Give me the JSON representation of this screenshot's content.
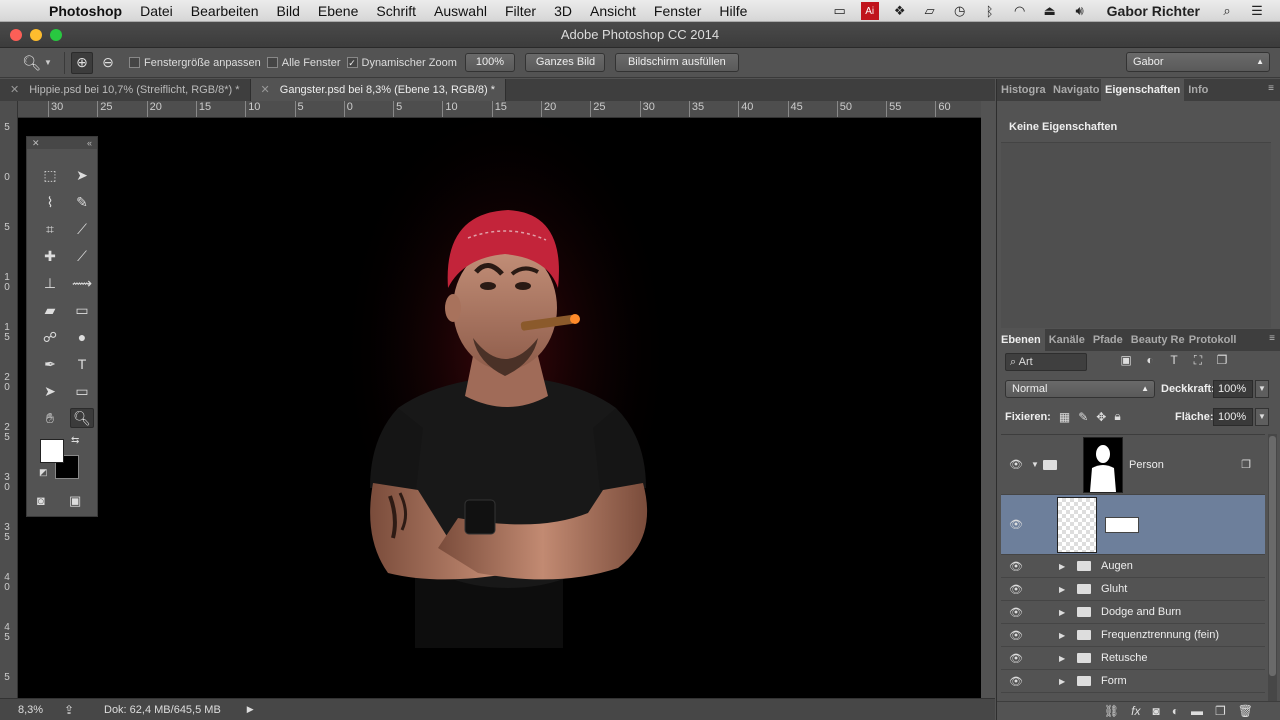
{
  "menubar": {
    "app": "Photoshop",
    "items": [
      "Datei",
      "Bearbeiten",
      "Bild",
      "Ebene",
      "Schrift",
      "Auswahl",
      "Filter",
      "3D",
      "Ansicht",
      "Fenster",
      "Hilfe"
    ],
    "user": "Gabor Richter",
    "status_icons": [
      "display-icon",
      "adobe-icon",
      "dropbox-icon",
      "airplay-icon",
      "timemachine-icon",
      "bluetooth-icon",
      "wifi-icon",
      "eject-icon",
      "volume-icon"
    ]
  },
  "window": {
    "title": "Adobe Photoshop CC 2014"
  },
  "options": {
    "fit_window": "Fenstergröße anpassen",
    "all_windows": "Alle Fenster",
    "dynamic_zoom": "Dynamischer Zoom",
    "zoom_value": "100%",
    "whole_image": "Ganzes Bild",
    "fill_screen": "Bildschirm ausfüllen",
    "workspace": "Gabor"
  },
  "doc_tabs": [
    {
      "label": "Hippie.psd bei 10,7% (Streiflicht, RGB/8*) *",
      "active": false
    },
    {
      "label": "Gangster.psd bei 8,3% (Ebene 13, RGB/8) *",
      "active": true
    }
  ],
  "ruler": {
    "h_ticks": [
      "30",
      "25",
      "20",
      "15",
      "10",
      "5",
      "0",
      "5",
      "10",
      "15",
      "20",
      "25",
      "30",
      "35",
      "40",
      "45",
      "50",
      "55",
      "60"
    ],
    "v_ticks": [
      "5",
      "0",
      "5",
      "1\n0",
      "1\n5",
      "2\n0",
      "2\n5",
      "3\n0",
      "3\n5",
      "4\n0",
      "4\n5",
      "5"
    ]
  },
  "status": {
    "zoom": "8,3%",
    "doc": "Dok: 62,4 MB/645,5 MB"
  },
  "top_panel": {
    "tabs": [
      "Histogra",
      "Navigato",
      "Eigenschaften",
      "Info"
    ],
    "active": "Eigenschaften",
    "empty_text": "Keine Eigenschaften"
  },
  "layers_panel": {
    "tabs": [
      "Ebenen",
      "Kanäle",
      "Pfade",
      "Beauty Rei",
      "Protokoll"
    ],
    "filter_label": "Art",
    "blend_mode": "Normal",
    "opacity_label": "Deckkraft:",
    "opacity_value": "100%",
    "lock_label": "Fixieren:",
    "fill_label": "Fläche:",
    "fill_value": "100%",
    "group_name": "Person",
    "layers": [
      "Augen",
      "Gluht",
      "Dodge and Burn",
      "Frequenztrennung (fein)",
      "Retusche",
      "Form"
    ]
  },
  "colors": {
    "selection": "#6d7f9b",
    "bandana": "#c3243a",
    "canvas": "#000000"
  }
}
